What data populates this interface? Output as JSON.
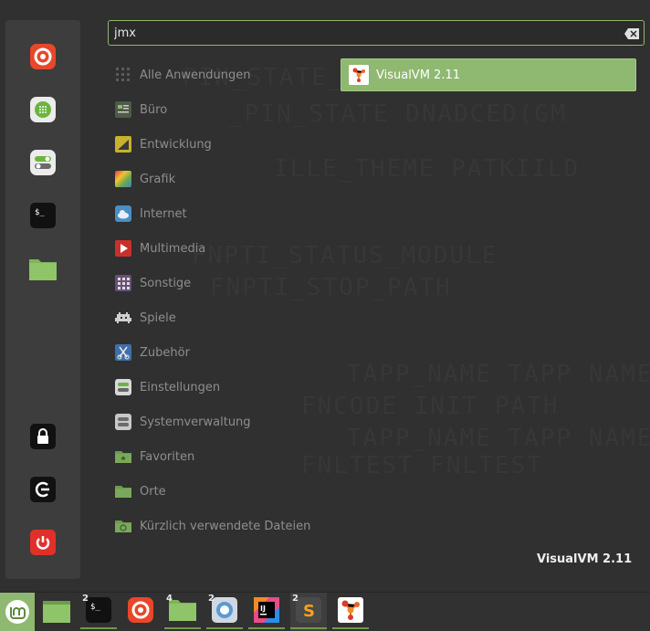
{
  "search": {
    "value": "jmx"
  },
  "categories": [
    {
      "label": "Alle Anwendungen",
      "icon": "grid-icon"
    },
    {
      "label": "Büro",
      "icon": "office-icon"
    },
    {
      "label": "Entwicklung",
      "icon": "development-icon"
    },
    {
      "label": "Grafik",
      "icon": "graphics-icon"
    },
    {
      "label": "Internet",
      "icon": "internet-cloud-icon"
    },
    {
      "label": "Multimedia",
      "icon": "multimedia-play-icon"
    },
    {
      "label": "Sonstige",
      "icon": "other-apps-icon"
    },
    {
      "label": "Spiele",
      "icon": "games-invader-icon"
    },
    {
      "label": "Zubehör",
      "icon": "accessories-scissors-icon"
    },
    {
      "label": "Einstellungen",
      "icon": "settings-toggle-icon"
    },
    {
      "label": "Systemverwaltung",
      "icon": "system-admin-icon"
    },
    {
      "label": "Favoriten",
      "icon": "favorites-folder-icon"
    },
    {
      "label": "Orte",
      "icon": "places-folder-icon"
    },
    {
      "label": "Kürzlich verwendete Dateien",
      "icon": "recent-files-folder-icon"
    }
  ],
  "result": {
    "label": "VisualVM 2.11",
    "icon": "visualvm-icon"
  },
  "description": {
    "title": "VisualVM 2.11"
  },
  "favorites": [
    "firefox-icon",
    "software-manager-icon",
    "settings-icon",
    "terminal-icon",
    "files-folder-icon"
  ],
  "session": [
    "lock-icon",
    "logout-icon",
    "power-icon"
  ],
  "taskbar": [
    {
      "icon": "mint-menu-icon"
    },
    {
      "icon": "show-desktop-icon"
    },
    {
      "icon": "terminal-icon",
      "count": "2"
    },
    {
      "icon": "firefox-icon"
    },
    {
      "icon": "files-folder-icon",
      "count": "4"
    },
    {
      "icon": "chromium-icon",
      "count": "2"
    },
    {
      "icon": "intellij-icon"
    },
    {
      "icon": "sublime-text-icon",
      "count": "2"
    },
    {
      "icon": "visualvm-icon"
    }
  ],
  "colors": {
    "accent": "#8fb870",
    "background": "#2f302f",
    "sidebar": "#3c3d3c"
  }
}
